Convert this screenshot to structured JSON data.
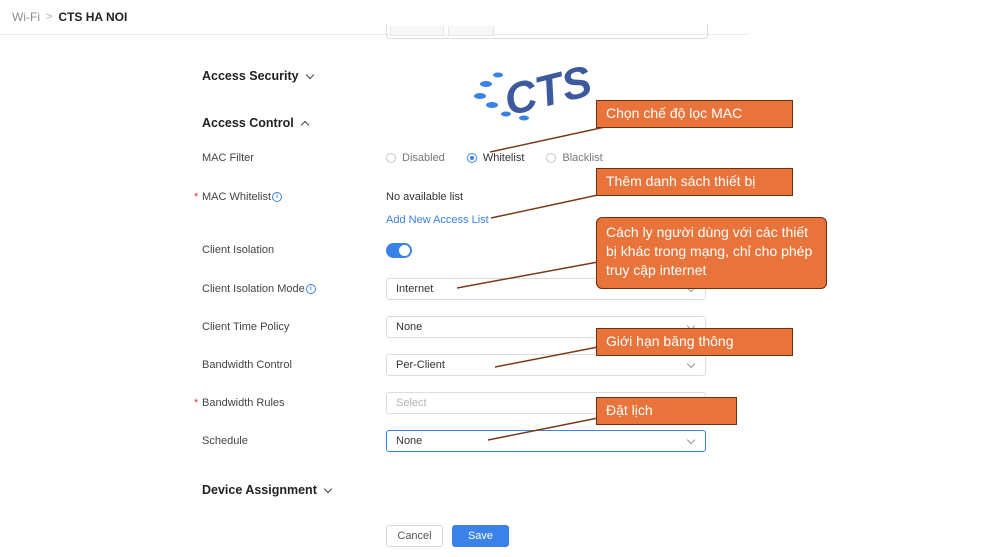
{
  "breadcrumb": {
    "parent": "Wi-Fi",
    "separator": ">",
    "current": "CTS HA NOI"
  },
  "logo": {
    "text": "CTS",
    "color": "#3d5a9e",
    "dots_color": "#3a82e8"
  },
  "sections": {
    "access_security": "Access Security",
    "access_control": "Access Control",
    "device_assignment": "Device Assignment"
  },
  "fields": {
    "mac_filter": {
      "label": "MAC Filter",
      "options": [
        "Disabled",
        "Whitelist",
        "Blacklist"
      ],
      "selected": "Whitelist"
    },
    "mac_whitelist": {
      "label": "MAC Whitelist",
      "value": "No available list",
      "link": "Add New Access List"
    },
    "client_isolation": {
      "label": "Client Isolation",
      "enabled": true
    },
    "client_isolation_mode": {
      "label": "Client Isolation Mode",
      "value": "Internet"
    },
    "client_time_policy": {
      "label": "Client Time Policy",
      "value": "None"
    },
    "bandwidth_control": {
      "label": "Bandwidth Control",
      "value": "Per-Client"
    },
    "bandwidth_rules": {
      "label": "Bandwidth Rules",
      "placeholder": "Select"
    },
    "schedule": {
      "label": "Schedule",
      "value": "None"
    }
  },
  "buttons": {
    "cancel": "Cancel",
    "save": "Save"
  },
  "callouts": {
    "mac_mode": "Chọn chế độ lọc MAC",
    "device_list": "Thêm danh sách thiết bị",
    "isolation": "Cách ly người dùng với các thiết bị khác trong mạng, chỉ cho phép truy cập internet",
    "bandwidth": "Giới hạn băng thông",
    "schedule": "Đặt lịch"
  },
  "colors": {
    "accent": "#3a82e8",
    "callout": "#e8743b",
    "required": "#e53935"
  }
}
